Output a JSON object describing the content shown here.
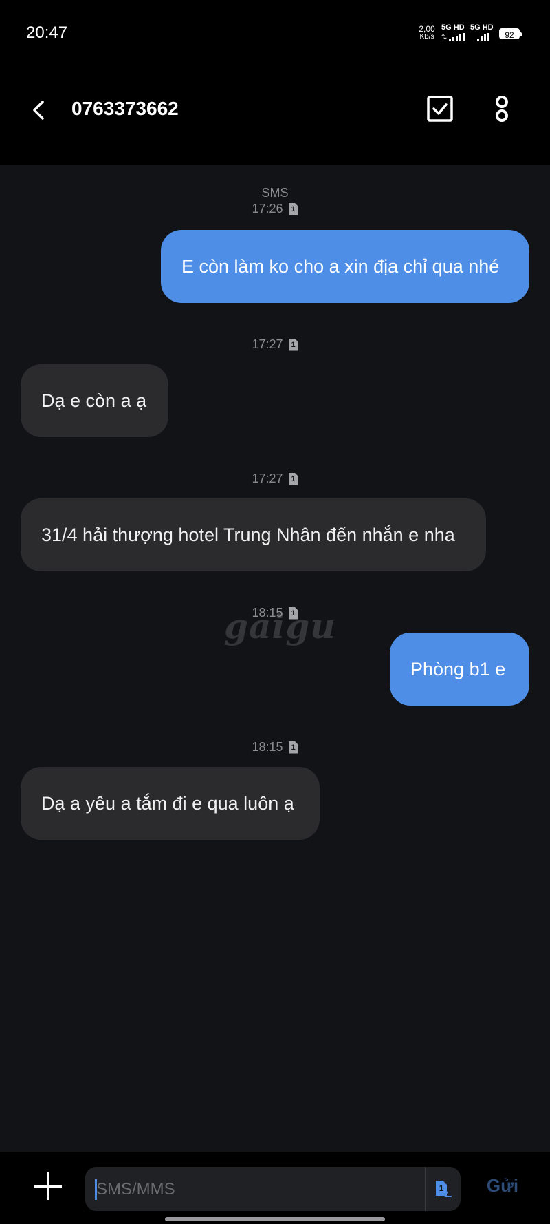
{
  "status_bar": {
    "time": "20:47",
    "net_speed_value": "2,00",
    "net_speed_unit": "KB/s",
    "sim1_label": "5G HD",
    "sim2_label": "5G HD",
    "battery": "92"
  },
  "header": {
    "contact": "0763373662",
    "back_icon": "chevron-left-icon",
    "select_icon": "checkbox-icon",
    "more_icon": "more-vertical-icon"
  },
  "conversation": {
    "channel_label": "SMS",
    "messages": [
      {
        "time": "17:26",
        "sim": "1",
        "direction": "outgoing",
        "text": "E còn làm ko cho a xin địa chỉ qua nhé"
      },
      {
        "time": "17:27",
        "sim": "1",
        "direction": "incoming",
        "text": "Dạ e còn a ạ"
      },
      {
        "time": "17:27",
        "sim": "1",
        "direction": "incoming",
        "text": "31/4 hải thượng hotel Trung Nhân đến nhắn e nha"
      },
      {
        "time": "18:15",
        "sim": "1",
        "direction": "outgoing",
        "text": "Phòng b1 e"
      },
      {
        "time": "18:15",
        "sim": "1",
        "direction": "incoming",
        "text": "Dạ a yêu a tắm đi e qua luôn ạ"
      }
    ],
    "watermark": "gaigu"
  },
  "composer": {
    "placeholder": "SMS/MMS",
    "value": "",
    "sim": "1",
    "send_label": "Gửi"
  },
  "colors": {
    "background": "#121316",
    "outgoing_bubble": "#4f8ee6",
    "incoming_bubble": "#2b2b2d"
  }
}
